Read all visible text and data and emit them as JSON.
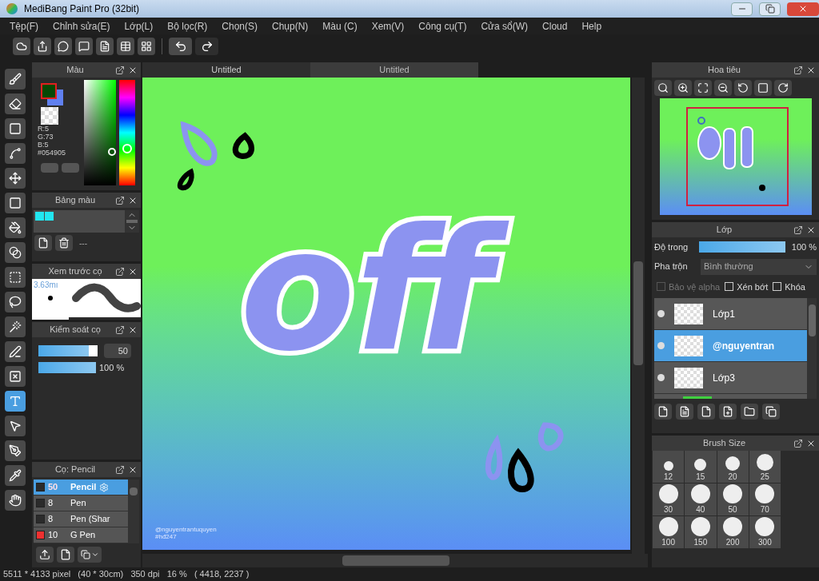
{
  "window": {
    "title": "MediBang Paint Pro (32bit)"
  },
  "menu": [
    "Tệp(F)",
    "Chỉnh sửa(E)",
    "Lớp(L)",
    "Bộ lọc(R)",
    "Chọn(S)",
    "Chụp(N)",
    "Màu (C)",
    "Xem(V)",
    "Công cụ(T)",
    "Cửa sổ(W)",
    "Cloud",
    "Help"
  ],
  "tools": [
    {
      "selected": false
    },
    {
      "selected": false
    },
    {
      "selected": false
    },
    {
      "selected": false
    },
    {
      "selected": false
    },
    {
      "selected": false
    },
    {
      "selected": false
    },
    {
      "selected": false
    },
    {
      "selected": false
    },
    {
      "selected": false
    },
    {
      "selected": false
    },
    {
      "selected": false
    },
    {
      "selected": false
    },
    {
      "selected": true
    },
    {
      "selected": false
    },
    {
      "selected": false
    },
    {
      "selected": false
    },
    {
      "selected": false
    }
  ],
  "color_panel": {
    "title": "Màu",
    "values": [
      "R:5",
      "G:73",
      "B:5",
      "#054905"
    ]
  },
  "palette_panel": {
    "title": "Bảng màu",
    "swatches": [
      {
        "color": "#22e6f0"
      },
      {
        "color": "#22e6f0"
      }
    ],
    "name": "---"
  },
  "brush_preview": {
    "title": "Xem trước cọ",
    "size": "3.63mı"
  },
  "brush_control": {
    "title": "Kiểm soát cọ",
    "size": {
      "level": 0.85,
      "reading": "50"
    },
    "opacity": {
      "level": 1,
      "reading": "100 %"
    }
  },
  "brush_list": {
    "title": "Cọ: Pencil",
    "items": [
      {
        "color": "#2b2b2b",
        "size": "50",
        "name": "Pencil",
        "selected": true
      },
      {
        "color": "#2b2b2b",
        "size": "8",
        "name": "Pen",
        "selected": false
      },
      {
        "color": "#2b2b2b",
        "size": "8",
        "name": "Pen (Shar",
        "selected": false
      },
      {
        "color": "#ee3030",
        "size": "10",
        "name": "G Pen",
        "selected": false
      }
    ]
  },
  "tabs": [
    {
      "label": "Untitled",
      "selected": true
    },
    {
      "label": "Untitled",
      "selected": false
    }
  ],
  "canvas": {
    "lettering": "off",
    "signature": [
      "@nguyentrantuquyen",
      "#hđ247"
    ]
  },
  "navigator": {
    "title": "Hoa tiêu"
  },
  "layer_panel": {
    "title": "Lớp",
    "opacity": {
      "label": "Độ trong",
      "level": 1,
      "reading": "100 %"
    },
    "blend": {
      "label": "Pha trộn",
      "value": "Bình thường"
    },
    "options": [
      {
        "label": "Bảo vệ alpha",
        "checked": false,
        "disabled": true
      },
      {
        "label": "Xén bớt",
        "checked": false,
        "disabled": false
      },
      {
        "label": "Khóa",
        "checked": false,
        "disabled": false
      }
    ],
    "layers": [
      {
        "name": "Lớp1",
        "selected": false
      },
      {
        "name": "@nguyentran",
        "selected": true
      },
      {
        "name": "Lớp3",
        "selected": false
      }
    ]
  },
  "brush_size": {
    "title": "Brush Size",
    "sizes": [
      "12",
      "15",
      "20",
      "25",
      "30",
      "40",
      "50",
      "70",
      "100",
      "150",
      "200",
      "300"
    ]
  },
  "status_bar": "5511 * 4133 pixel   (40 * 30cm)   350 dpi   16 %   ( 4418, 2237 )"
}
